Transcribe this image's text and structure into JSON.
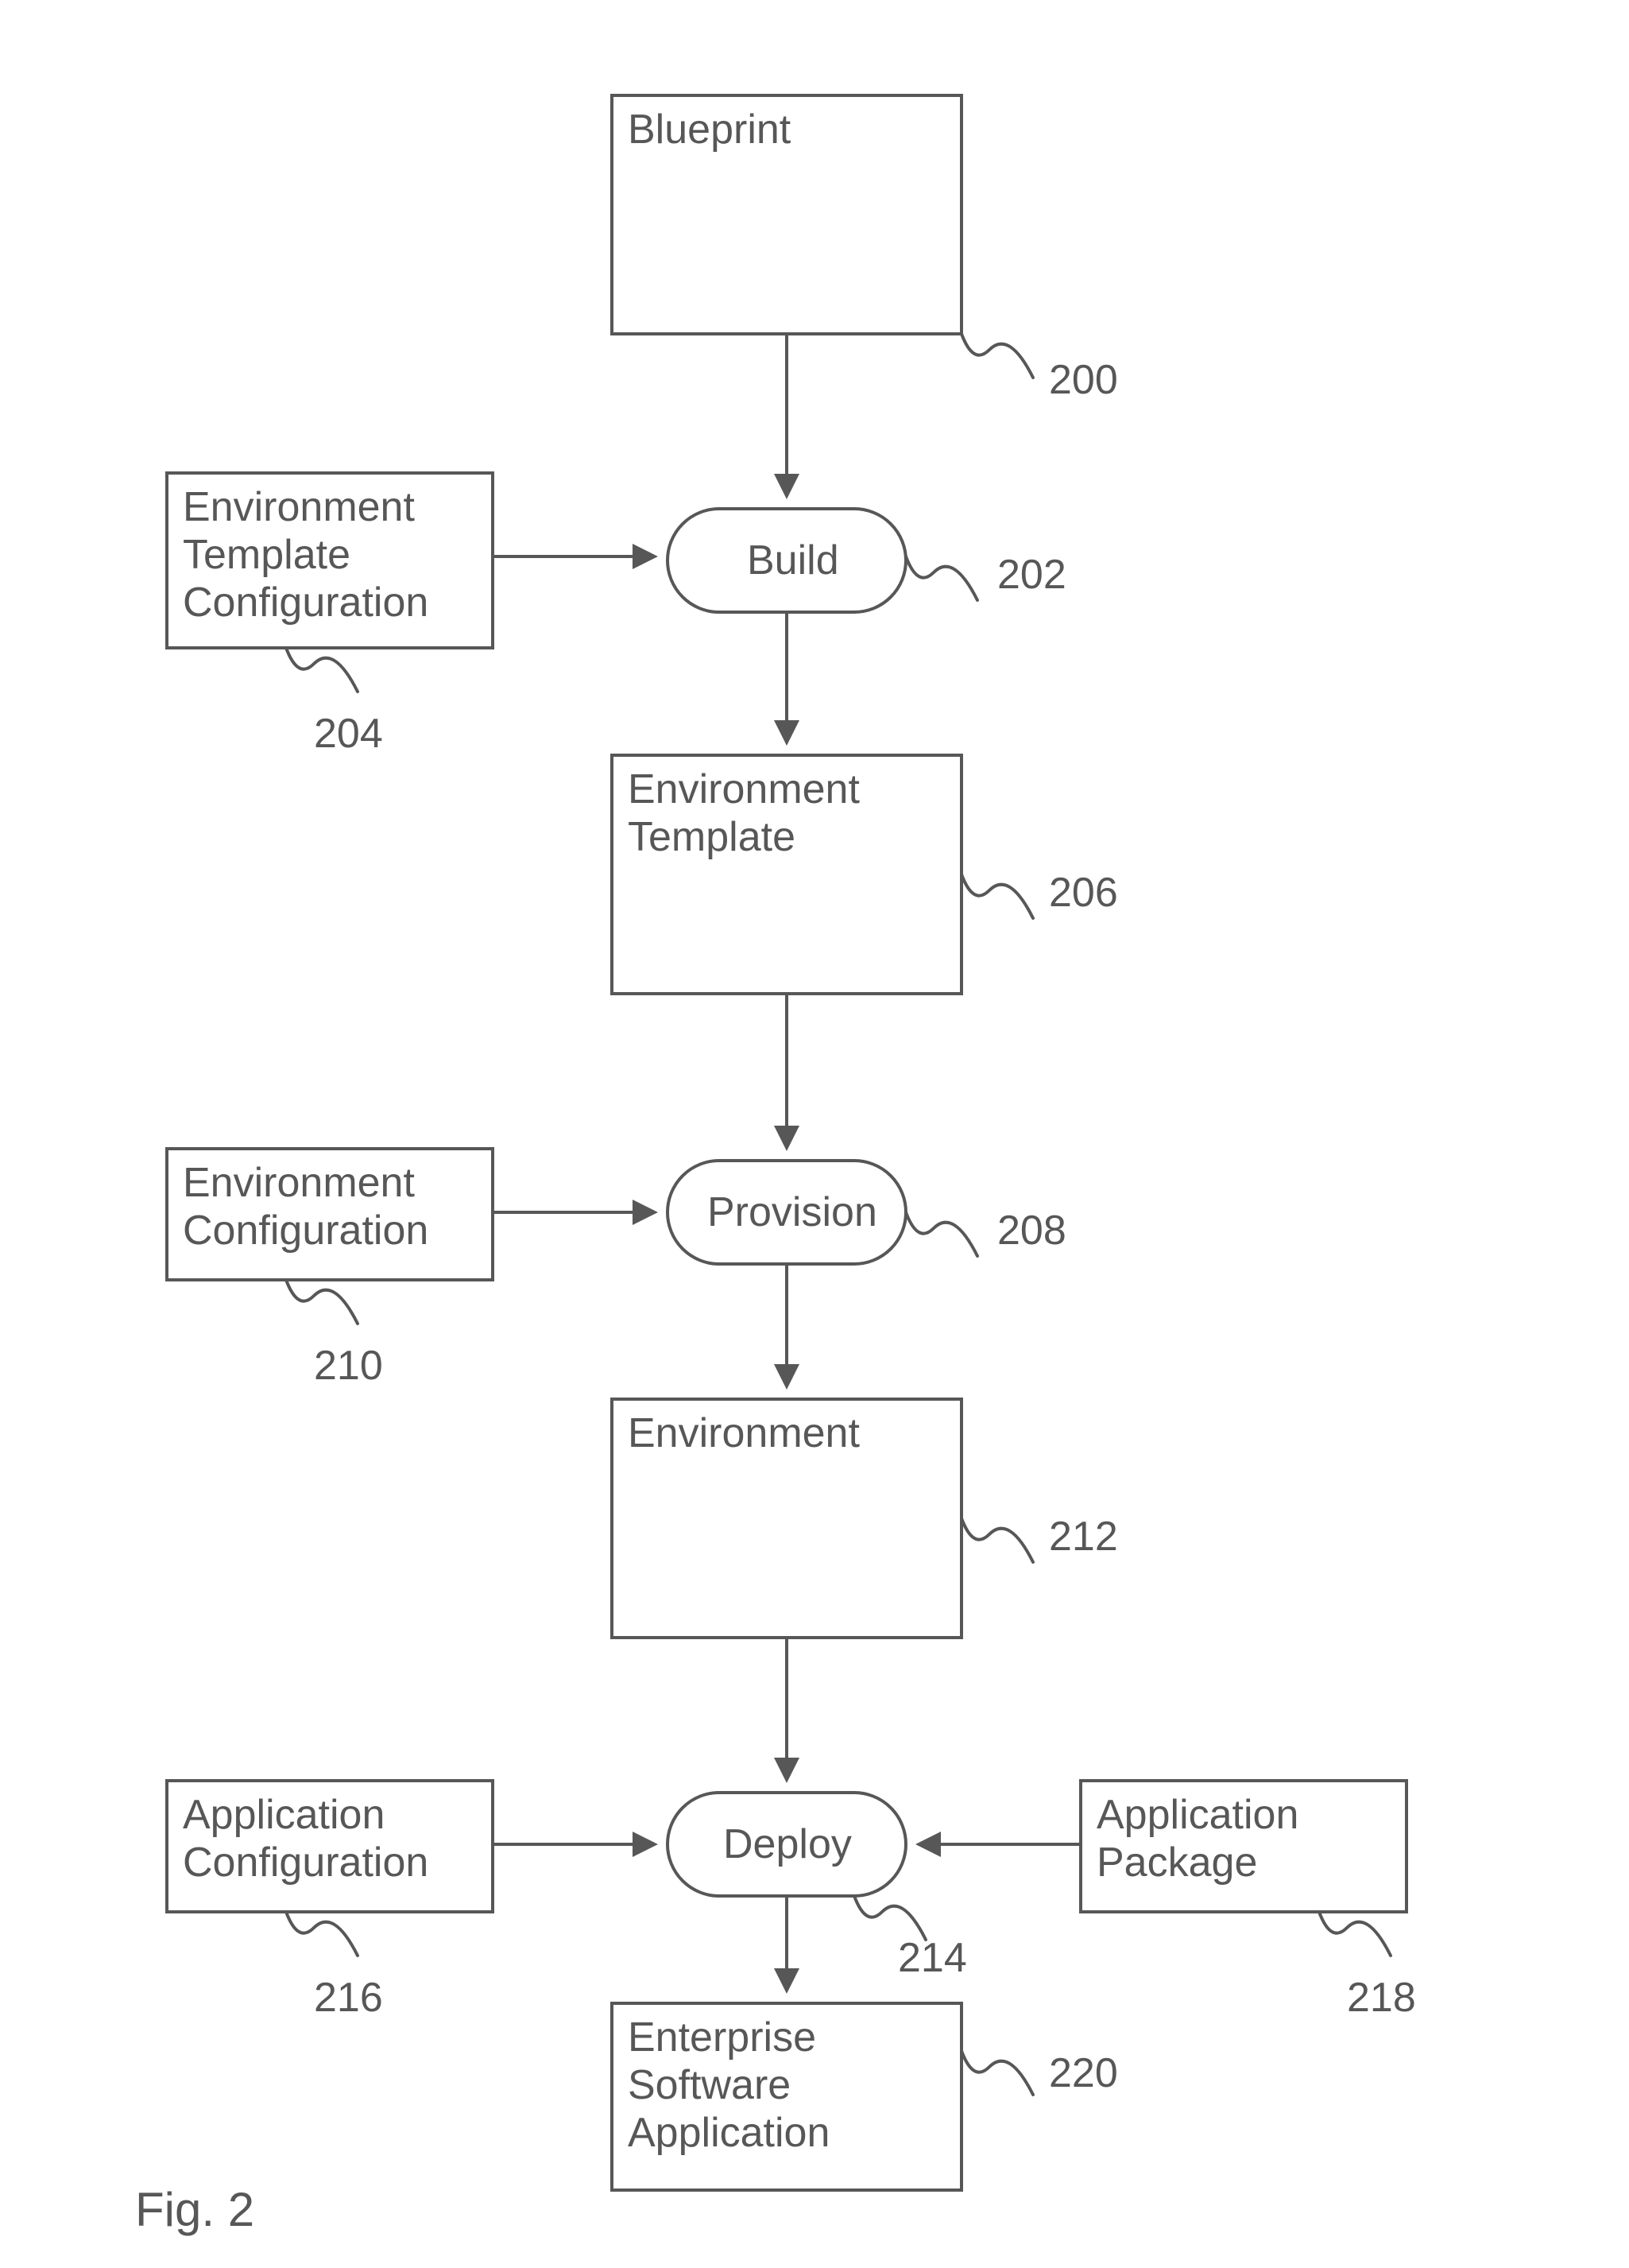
{
  "figure_label": "Fig. 2",
  "nodes": {
    "blueprint": {
      "label": "Blueprint",
      "ref": "200"
    },
    "build": {
      "label": "Build",
      "ref": "202"
    },
    "env_tmpl_config": {
      "label": "Environment\nTemplate\nConfiguration",
      "ref": "204"
    },
    "env_template": {
      "label": "Environment\nTemplate",
      "ref": "206"
    },
    "provision": {
      "label": "Provision",
      "ref": "208"
    },
    "env_config": {
      "label": "Environment\nConfiguration",
      "ref": "210"
    },
    "environment": {
      "label": "Environment",
      "ref": "212"
    },
    "deploy": {
      "label": "Deploy",
      "ref": "214"
    },
    "app_config": {
      "label": "Application\nConfiguration",
      "ref": "216"
    },
    "app_package": {
      "label": "Application\nPackage",
      "ref": "218"
    },
    "ent_sw_app": {
      "label": "Enterprise\nSoftware\nApplication",
      "ref": "220"
    }
  }
}
